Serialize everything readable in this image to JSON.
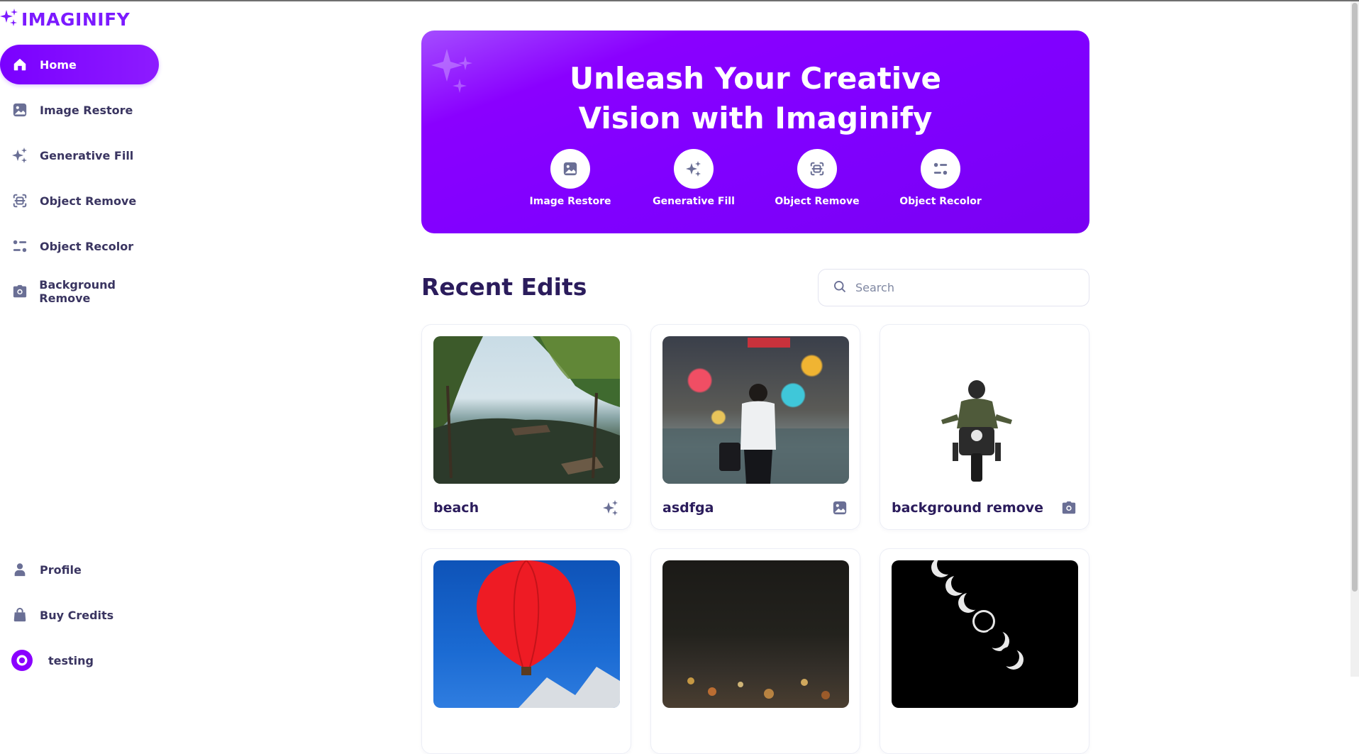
{
  "app": {
    "logo_text": "IMAGINIFY",
    "accent": "#7c1aff"
  },
  "sidebar": {
    "items": [
      {
        "label": "Home",
        "icon": "home-icon",
        "active": true
      },
      {
        "label": "Image Restore",
        "icon": "image-icon"
      },
      {
        "label": "Generative Fill",
        "icon": "sparkles-icon"
      },
      {
        "label": "Object Remove",
        "icon": "scan-icon"
      },
      {
        "label": "Object Recolor",
        "icon": "filter-icon"
      },
      {
        "label": "Background Remove",
        "icon": "camera-icon"
      }
    ],
    "bottom": [
      {
        "label": "Profile",
        "icon": "user-icon"
      },
      {
        "label": "Buy Credits",
        "icon": "bag-icon"
      }
    ],
    "user": {
      "name": "testing"
    }
  },
  "banner": {
    "title_line1": "Unleash Your Creative",
    "title_line2": "Vision with Imaginify",
    "actions": [
      {
        "label": "Image Restore",
        "icon": "image-icon"
      },
      {
        "label": "Generative Fill",
        "icon": "sparkles-icon"
      },
      {
        "label": "Object Remove",
        "icon": "scan-icon"
      },
      {
        "label": "Object Recolor",
        "icon": "filter-icon"
      }
    ]
  },
  "recent": {
    "title": "Recent Edits",
    "search_placeholder": "Search",
    "cards": [
      {
        "name": "beach",
        "type_icon": "sparkles-icon"
      },
      {
        "name": "asdfga",
        "type_icon": "image-icon"
      },
      {
        "name": "background remove",
        "type_icon": "camera-icon"
      },
      {
        "name": "",
        "type_icon": ""
      },
      {
        "name": "",
        "type_icon": ""
      },
      {
        "name": "",
        "type_icon": ""
      }
    ]
  }
}
